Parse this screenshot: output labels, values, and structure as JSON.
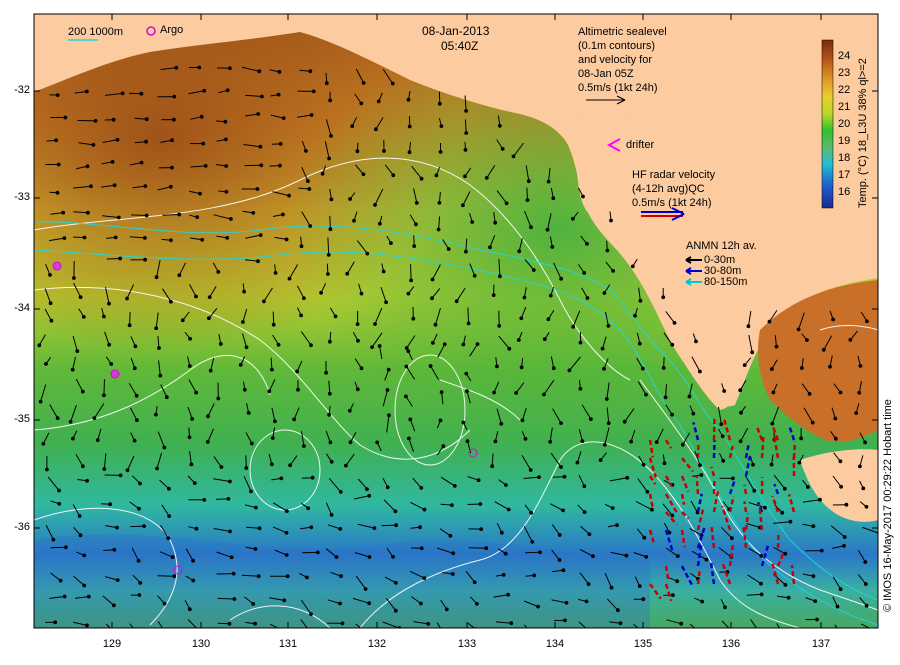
{
  "header": {
    "date": "08-Jan-2013",
    "time": "05:40Z"
  },
  "depth_legend": {
    "label": "200  1000m"
  },
  "argo_legend": {
    "label": "Argo"
  },
  "altimetry_note": {
    "lines": [
      "Altimetric sealevel",
      "(0.1m contours)",
      "and velocity for",
      "08-Jan 05Z",
      "0.5m/s (1kt 24h)"
    ]
  },
  "drifter_legend": {
    "label": "drifter"
  },
  "hf_radar_note": {
    "lines": [
      "HF radar velocity",
      "(4-12h avg)QC",
      "0.5m/s (1kt 24h)"
    ]
  },
  "anmn_legend": {
    "title": "ANMN 12h av.",
    "items": [
      {
        "label": "0-30m",
        "color": "#000000"
      },
      {
        "label": "30-80m",
        "color": "#0000cc"
      },
      {
        "label": "80-150m",
        "color": "#00c8d0"
      }
    ]
  },
  "colorbar": {
    "label": "Temp. (°C) 18_L3U 38% ql>=2",
    "ticks": [
      "24",
      "23",
      "22",
      "21",
      "20",
      "19",
      "18",
      "17",
      "16"
    ],
    "range": [
      15.3,
      24.9
    ]
  },
  "credit": "© IMOS 16-May-2017 00:29:22 Hobart time",
  "axes": {
    "x_ticks": [
      "129",
      "130",
      "131",
      "132",
      "133",
      "134",
      "135",
      "136",
      "137"
    ],
    "y_ticks": [
      "-32",
      "-33",
      "-34",
      "-35",
      "-36"
    ]
  },
  "colors": {
    "land": "#fdcba0",
    "argo": "#e000e0",
    "drifter": "#ff00ff",
    "hf_radar": "#cc0000"
  }
}
